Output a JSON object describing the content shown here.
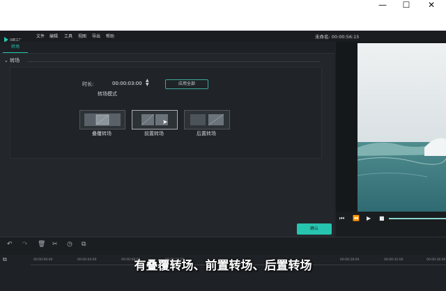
{
  "window": {
    "minimize": "—",
    "maximize": "☐",
    "close": "✕"
  },
  "menu": {
    "logo_text": "迅影工厂",
    "items": [
      "文件",
      "编辑",
      "工具",
      "视图",
      "导出",
      "帮助"
    ]
  },
  "project": {
    "title": "未命名: 00:00:56:15"
  },
  "panel": {
    "tab": "转场",
    "section": "转场",
    "duration_label": "时长:",
    "duration_value": "00:00:03:00",
    "apply_all": "应用全部",
    "mode_label": "转场模式",
    "modes": [
      "叠覆转场",
      "前置转场",
      "后置转场"
    ],
    "confirm": "确认"
  },
  "timeline": {
    "ticks": [
      "00:00:00:00",
      "00:00:04:00",
      "00:00:08:00",
      "00:00:12:00",
      "00:00:28:00",
      "00:00:32:00",
      "00:00:36:00"
    ]
  },
  "caption": "有叠覆转场、前置转场、后置转场",
  "colors": {
    "accent": "#27c4b0"
  }
}
